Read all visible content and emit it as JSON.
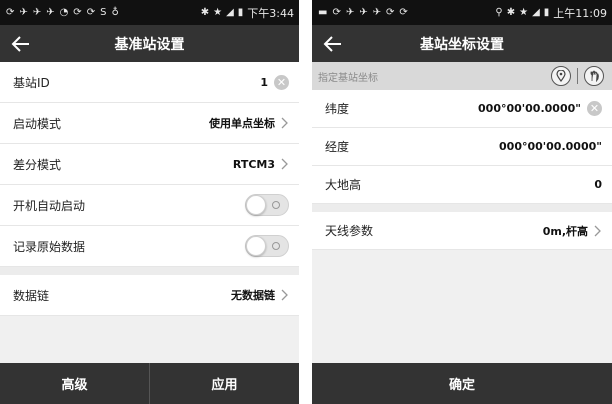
{
  "left": {
    "status": {
      "time": "下午3:44"
    },
    "title": "基准站设置",
    "rows": [
      {
        "label": "基站ID",
        "value": "1"
      },
      {
        "label": "启动模式",
        "value": "使用单点坐标"
      },
      {
        "label": "差分模式",
        "value": "RTCM3"
      },
      {
        "label": "开机自动启动",
        "toggle": false
      },
      {
        "label": "记录原始数据",
        "toggle": false
      },
      {
        "label": "数据链",
        "value": "无数据链"
      }
    ],
    "buttons": {
      "advanced": "高级",
      "apply": "应用"
    }
  },
  "right": {
    "status": {
      "time": "上午11:09"
    },
    "title": "基站坐标设置",
    "section_header": "指定基站坐标",
    "rows": [
      {
        "label": "纬度",
        "value": "000°00'00.0000\""
      },
      {
        "label": "经度",
        "value": "000°00'00.0000\""
      },
      {
        "label": "大地高",
        "value": "0"
      },
      {
        "label": "天线参数",
        "value": "0m,杆高"
      }
    ],
    "buttons": {
      "confirm": "确定"
    }
  },
  "colors": {
    "titlebar": "#333333",
    "statusbar": "#111111",
    "section_header": "#d9d9d9"
  }
}
